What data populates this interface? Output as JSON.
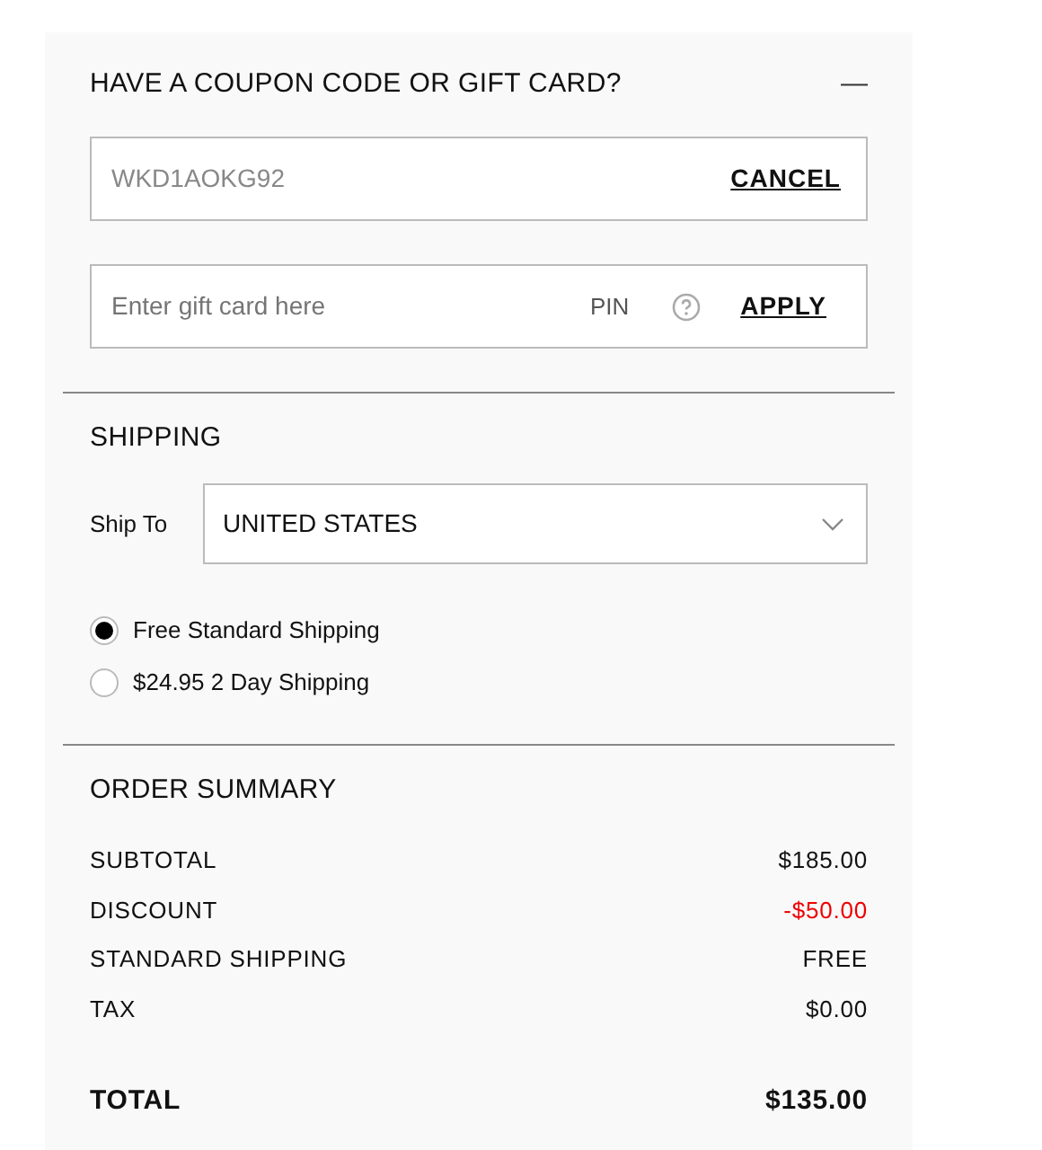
{
  "coupon": {
    "heading": "HAVE A COUPON CODE OR GIFT CARD?",
    "expanded": true,
    "collapse_icon": "—",
    "code_field": {
      "value": "WKD1AOKG92",
      "action": "CANCEL"
    },
    "gift_field": {
      "placeholder": "Enter gift card here",
      "pin": "PIN",
      "action": "APPLY"
    }
  },
  "shipping": {
    "heading": "SHIPPING",
    "ship_to_label": "Ship To",
    "country": "UNITED STATES",
    "options": [
      {
        "label": "Free Standard Shipping",
        "selected": true
      },
      {
        "label": "$24.95 2 Day Shipping",
        "selected": false
      }
    ]
  },
  "order_summary": {
    "heading": "ORDER SUMMARY",
    "rows": [
      {
        "label": "SUBTOTAL",
        "value": "$185.00",
        "kind": "normal"
      },
      {
        "label": "DISCOUNT",
        "value": "-$50.00",
        "kind": "discount"
      },
      {
        "label": "STANDARD SHIPPING",
        "value": "FREE",
        "kind": "normal"
      },
      {
        "label": "TAX",
        "value": "$0.00",
        "kind": "normal"
      }
    ],
    "total": {
      "label": "TOTAL",
      "value": "$135.00"
    }
  }
}
